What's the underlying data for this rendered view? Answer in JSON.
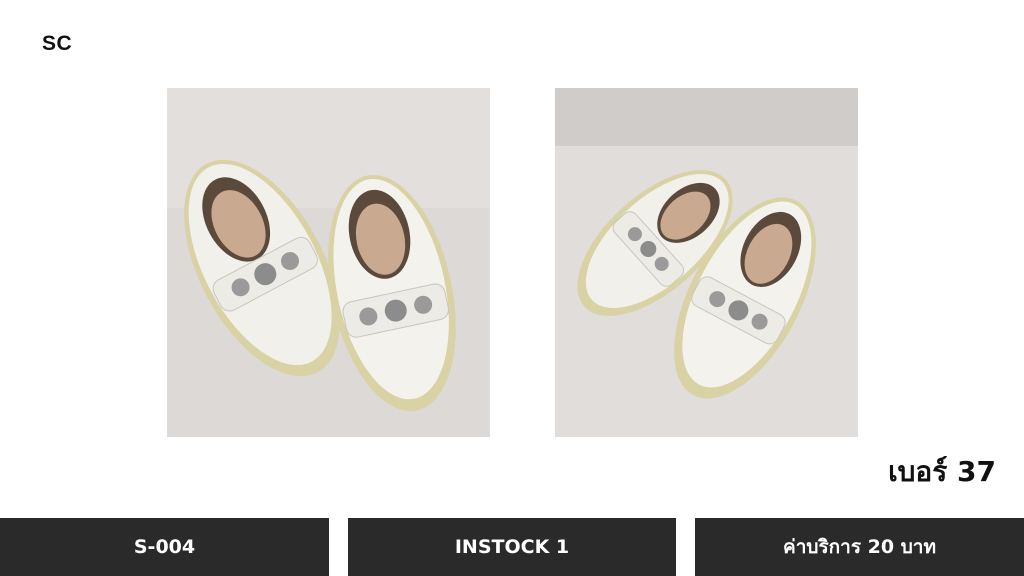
{
  "brand": "SC",
  "size_label": "เบอร์ 37",
  "footer": {
    "sku": "S-004",
    "stock": "INSTOCK 1",
    "fee": "ค่าบริการ 20 บาท"
  },
  "images": [
    {
      "subject": "white slip-on shoes with jeweled strap",
      "view": "front-angle"
    },
    {
      "subject": "white slip-on shoes with jeweled strap",
      "view": "side-angle"
    }
  ],
  "colors": {
    "bar_bg": "#2a2a2a",
    "bar_text": "#ffffff",
    "text": "#111111",
    "photo_bg": "#dedbd8"
  }
}
